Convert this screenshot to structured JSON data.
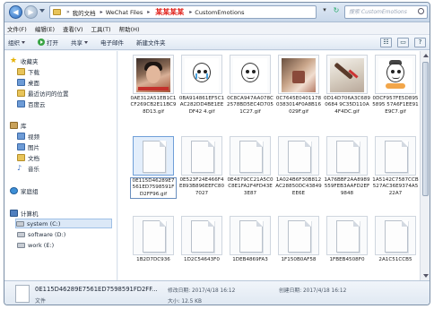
{
  "breadcrumb": {
    "part1": "我的文档",
    "part2": "WeChat Files",
    "annotation": "某某某某",
    "part3": "CustomEmotions"
  },
  "search": {
    "placeholder": "搜索 CustomEmotions"
  },
  "menu": [
    "文件(F)",
    "编辑(E)",
    "查看(V)",
    "工具(T)",
    "帮助(H)"
  ],
  "toolbar": {
    "organize": "组织",
    "open": "打开",
    "share": "共享",
    "email": "电子邮件",
    "new_folder": "新建文件夹"
  },
  "sidebar": {
    "favorites": "收藏夹",
    "downloads": "下载",
    "desktop": "桌面",
    "recent": "最近访问的位置",
    "baidu": "百度云",
    "libraries": "库",
    "videos": "视频",
    "pictures": "图片",
    "documents": "文档",
    "music": "音乐",
    "homegroup": "家庭组",
    "computer": "计算机",
    "drive_c": "system (C:)",
    "drive_d": "software (D:)",
    "drive_e": "work (E:)"
  },
  "files_row1": [
    "0AE312A51EB1C1CF269CB2E11BC98D13.gif",
    "0BA914861EF5C1AC282DD4BE1EEDF42 4.gif",
    "0C8CA947AA078C2578BD5EC4D7051C27.gif",
    "0C7645E04011780383014F0A8B16029F.gif",
    "0D14D706A3C6890684 9C35D110A4F4DC.gif",
    "0DCF957FE5D8955895 57A6F1EE91E9C7.gif"
  ],
  "files_row2": [
    "0E115D46289E7561ED7598591FD2FF96.gif",
    "0E523F24E466F4E893B896EEFC807027",
    "0E4879CC21A5C0C8E1FA2F4FD43E3E87",
    "1A024B6F30B812AC28850DC43849EE6E",
    "1A76BBF2AA8989559FEB3AAFD2EF9848",
    "1A5142C7587CCB527AC36E9374A522A7"
  ],
  "files_row3": [
    "1B2D7DC936",
    "1D2C54643F0",
    "1DEB4869FA3",
    "1F150B0AF58",
    "1FBEB4508F0",
    "2A1C51CCB5"
  ],
  "details": {
    "name": "0E115D46289E7561ED7598591FD2FF...",
    "type": "文件",
    "modified": "修改日期: 2017/4/18 16:12",
    "size": "大小: 12.5 KB",
    "created": "创建日期: 2017/4/18 16:12"
  },
  "colors": {
    "annotation": "#e0211a",
    "selection": "#dbe8f7",
    "window_frame": "#7a8ea6"
  }
}
